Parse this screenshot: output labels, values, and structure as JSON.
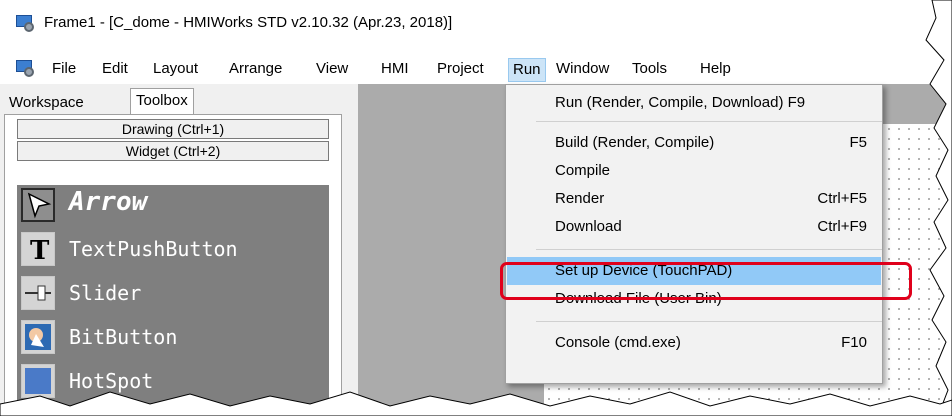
{
  "window": {
    "title": "Frame1 - [C_dome - HMIWorks STD v2.10.32 (Apr.23, 2018)]",
    "icon": "hmiworks-app-icon"
  },
  "menubar": {
    "items": [
      "File",
      "Edit",
      "Layout",
      "Arrange",
      "View",
      "HMI",
      "Project",
      "Run",
      "Window",
      "Tools",
      "Help"
    ],
    "active": "Run"
  },
  "left_panel": {
    "tabs": [
      "Workspace",
      "Toolbox"
    ],
    "selected_tab": "Toolbox",
    "categories": [
      "Drawing (Ctrl+1)",
      "Widget (Ctrl+2)"
    ],
    "tools": [
      {
        "label": "Arrow",
        "icon": "arrow-pointer-icon"
      },
      {
        "label": "TextPushButton",
        "icon": "text-push-button-icon"
      },
      {
        "label": "Slider",
        "icon": "slider-icon"
      },
      {
        "label": "BitButton",
        "icon": "bit-button-icon"
      },
      {
        "label": "HotSpot",
        "icon": "hotspot-icon"
      }
    ]
  },
  "run_menu": {
    "items": [
      {
        "label": "Run (Render, Compile, Download) F9",
        "shortcut": ""
      },
      {
        "label": "Build (Render, Compile)",
        "shortcut": "F5"
      },
      {
        "label": "Compile",
        "shortcut": ""
      },
      {
        "label": "Render",
        "shortcut": "Ctrl+F5"
      },
      {
        "label": "Download",
        "shortcut": "Ctrl+F9"
      },
      {
        "label": "Set up Device (TouchPAD)",
        "shortcut": ""
      },
      {
        "label": "Download File (User Bin)",
        "shortcut": ""
      },
      {
        "label": "Console (cmd.exe)",
        "shortcut": "F10"
      }
    ],
    "highlighted": "Set up Device (TouchPAD)",
    "highlight_color": "#91c9f7",
    "annotation_color": "#e0001b"
  }
}
